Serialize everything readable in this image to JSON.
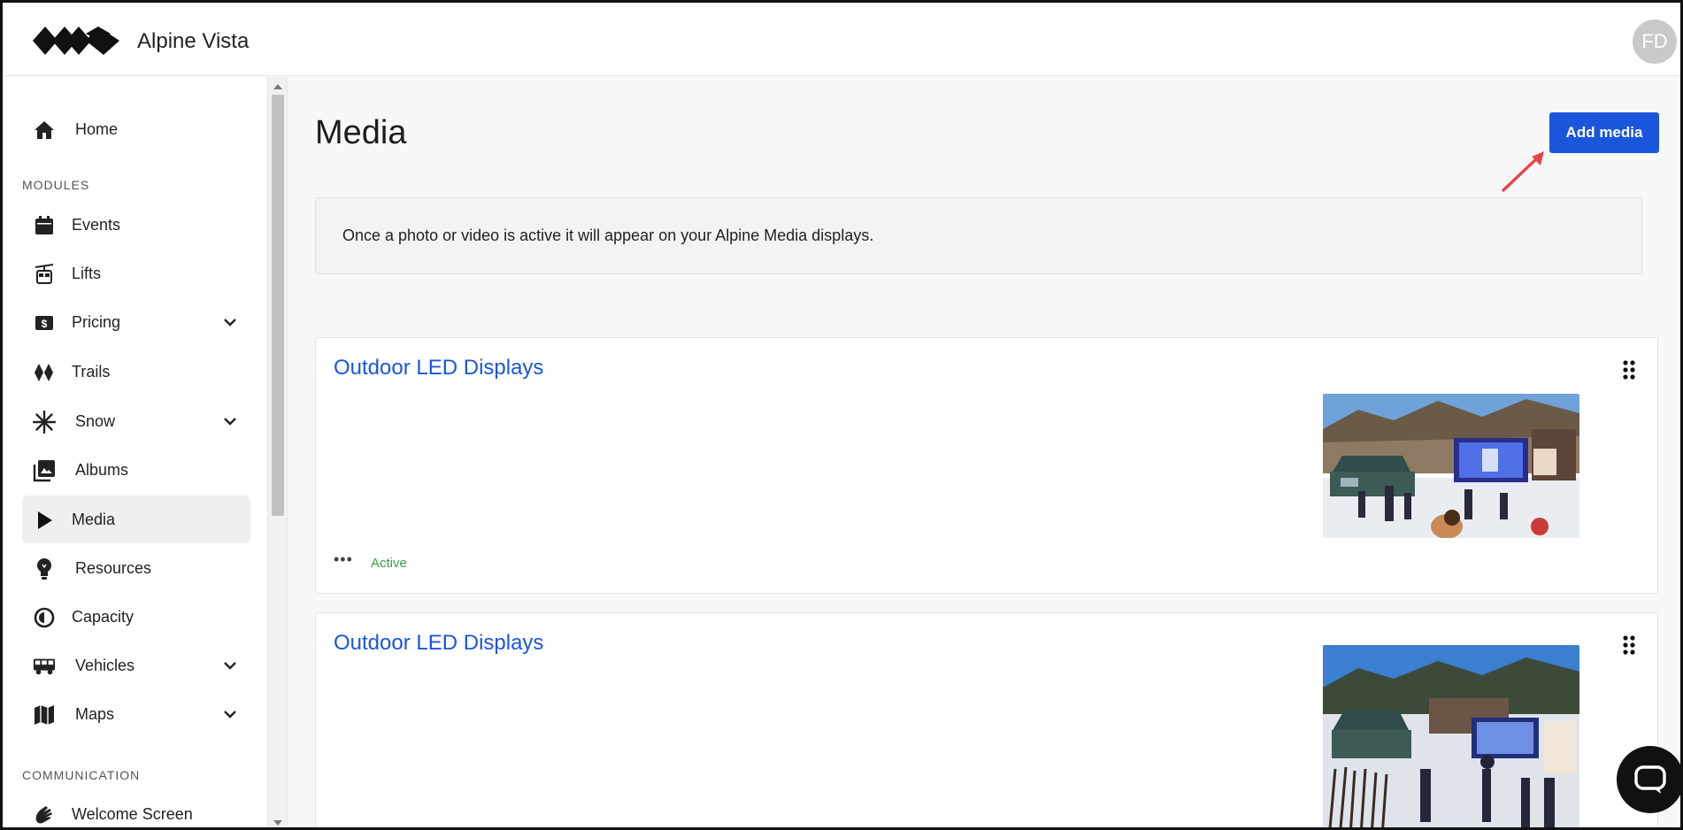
{
  "app": {
    "title": "Alpine Vista",
    "user_initials": "FD"
  },
  "sidebar": {
    "home": "Home",
    "modules_label": "MODULES",
    "items": [
      {
        "label": "Events"
      },
      {
        "label": "Lifts"
      },
      {
        "label": "Pricing"
      },
      {
        "label": "Trails"
      },
      {
        "label": "Snow"
      },
      {
        "label": "Albums"
      },
      {
        "label": "Media"
      },
      {
        "label": "Resources"
      },
      {
        "label": "Capacity"
      },
      {
        "label": "Vehicles"
      },
      {
        "label": "Maps"
      }
    ],
    "communication_label": "COMMUNICATION",
    "welcome": "Welcome Screen"
  },
  "main": {
    "title": "Media",
    "add_button": "Add media",
    "info": "Once a photo or video is active it will appear on your Alpine Media displays.",
    "cards": [
      {
        "title": "Outdoor LED Displays",
        "status": "Active",
        "more": "•••"
      },
      {
        "title": "Outdoor LED Displays"
      }
    ]
  },
  "colors": {
    "accent": "#1a56db",
    "active_status": "#3aa04a",
    "arrow": "#e8434a"
  }
}
